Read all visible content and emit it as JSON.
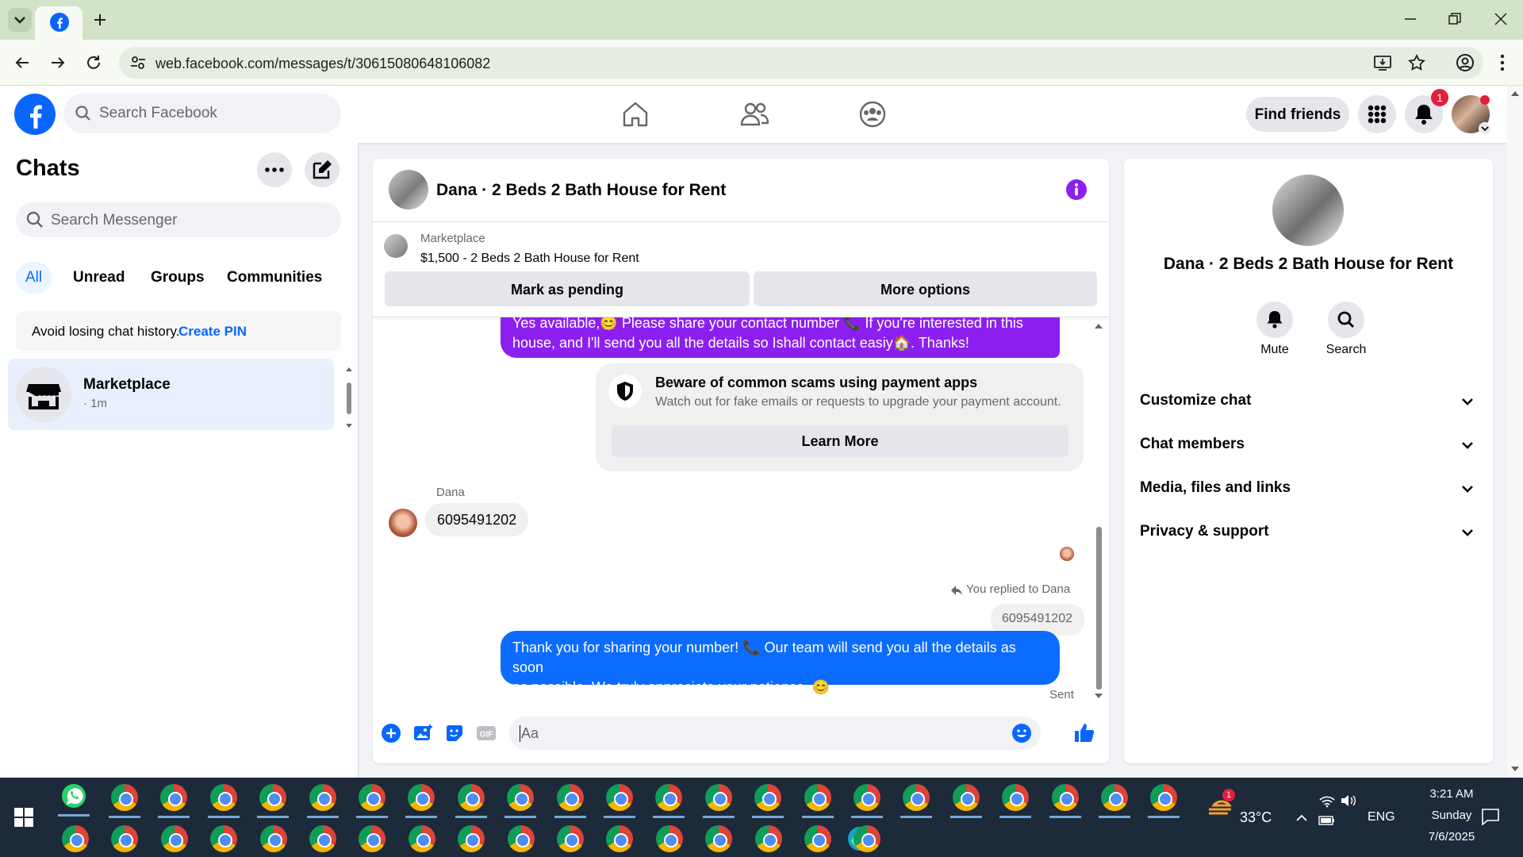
{
  "browser": {
    "url": "web.facebook.com/messages/t/30615080648106082"
  },
  "fb_header": {
    "search_placeholder": "Search Facebook",
    "find_friends_label": "Find friends",
    "notification_count": "1"
  },
  "sidebar": {
    "title": "Chats",
    "search_placeholder": "Search Messenger",
    "filters": [
      "All",
      "Unread",
      "Groups",
      "Communities"
    ],
    "pin_notice": "Avoid losing chat history.",
    "pin_link": "Create PIN",
    "chat_item": {
      "name": "Marketplace",
      "meta": "· 1m"
    }
  },
  "conversation": {
    "title": "Dana · 2 Beds 2 Bath House for Rent",
    "listing_source": "Marketplace",
    "listing_title": "$1,500 - 2 Beds 2 Bath House for Rent",
    "mark_pending_label": "Mark as pending",
    "more_options_label": "More options",
    "messages": {
      "first_out_line1": "Yes available,😊 Please share your contact number 📞 If you're interested in this",
      "first_out_line2": "house, and I'll send you all the details  so Ishall contact easiy🏠. Thanks!",
      "scam_title": "Beware of common scams using payment apps",
      "scam_body": "Watch out for fake emails or requests to upgrade your payment account.",
      "learn_more": "Learn More",
      "sender_name": "Dana",
      "incoming_number": "6095491202",
      "replied_to": "You replied to Dana",
      "quoted_number": "6095491202",
      "reply_line1": "Thank you for sharing your number! 📞 Our team will send you all the details as soon",
      "reply_line2": "as possible. We truly appreciate your patience. 😊",
      "status": "Sent"
    },
    "composer_placeholder": "Aa"
  },
  "info_panel": {
    "title": "Dana · 2 Beds 2 Bath House for Rent",
    "mute_label": "Mute",
    "search_label": "Search",
    "sections": [
      "Customize chat",
      "Chat members",
      "Media, files and links",
      "Privacy & support"
    ]
  },
  "taskbar": {
    "weather_temp": "33°C",
    "weather_badge": "1",
    "language": "ENG",
    "time": "3:21 AM",
    "day": "Sunday",
    "date": "7/6/2025"
  },
  "colors": {
    "fb_blue": "#0866ff",
    "messenger_blue": "#0b6cff",
    "purple_bubble": "#8c1ff0",
    "notif_red": "#e41e3f"
  }
}
